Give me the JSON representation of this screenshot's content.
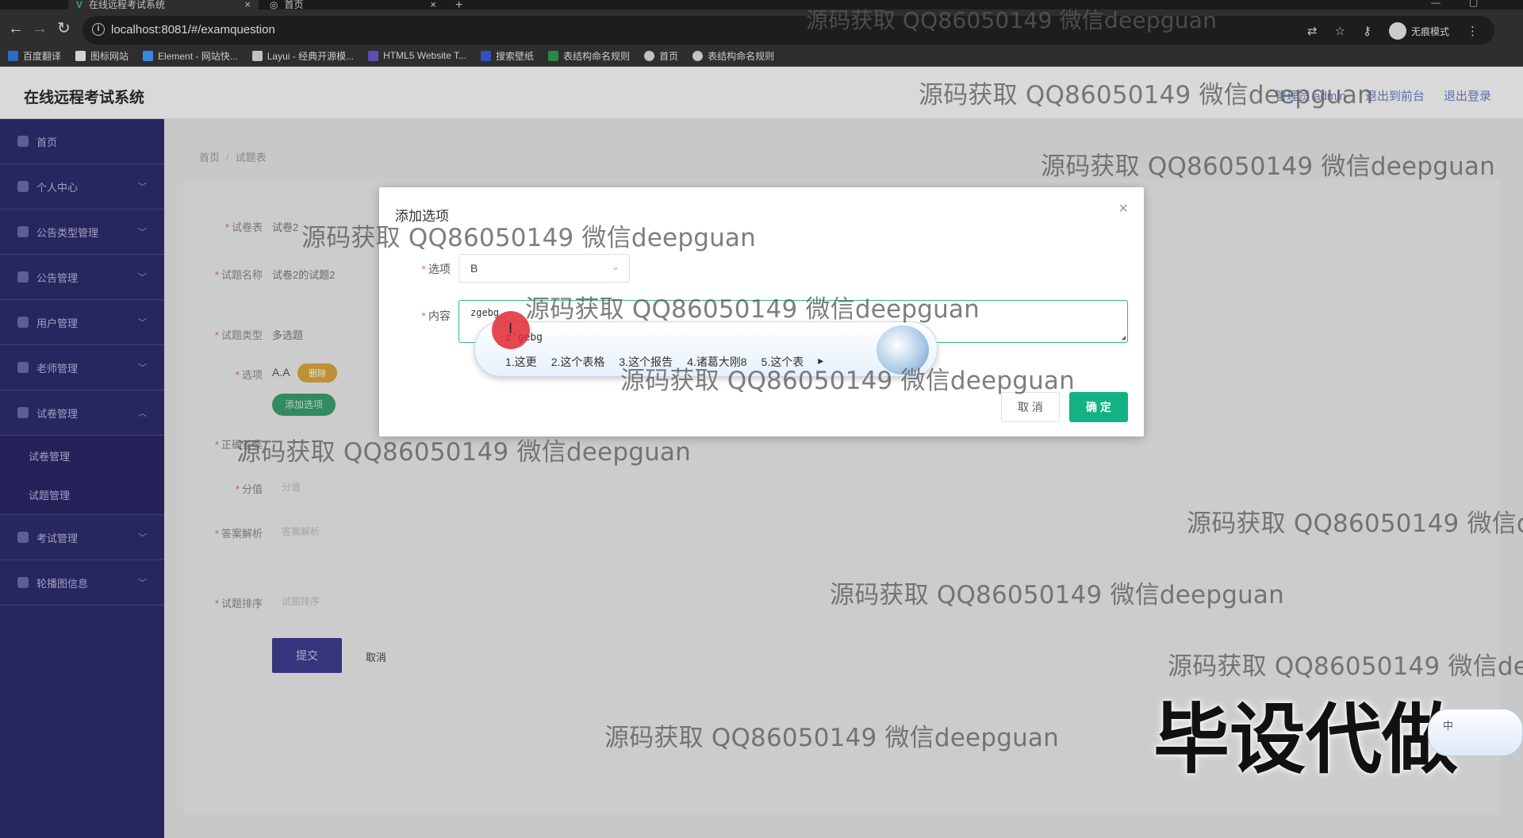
{
  "browser": {
    "tabs": [
      {
        "title": "在线远程考试系统",
        "active": true
      },
      {
        "title": "首页",
        "active": false
      }
    ],
    "url": "localhost:8081/#/examquestion",
    "incognito_label": "无痕模式",
    "bookmarks": [
      {
        "label": "百度翻译",
        "color": "#2f7de1"
      },
      {
        "label": "图标网站",
        "color": "#f0f0f0"
      },
      {
        "label": "Element - 网站快...",
        "color": "#409eff"
      },
      {
        "label": "Layui - 经典开源模...",
        "color": "#dddddd"
      },
      {
        "label": "HTML5 Website T...",
        "color": "#6a5acd"
      },
      {
        "label": "搜索壁纸",
        "color": "#3b5bdb"
      },
      {
        "label": "表结构命名规则",
        "color": "#2e9e4f"
      },
      {
        "label": "首页",
        "color": "#dddddd"
      },
      {
        "label": "表结构命名规则",
        "color": "#dddddd"
      }
    ]
  },
  "header": {
    "title": "在线远程考试系统",
    "links": [
      "管理员 admin",
      "退出到前台",
      "退出登录"
    ]
  },
  "sidebar": {
    "items": [
      {
        "label": "首页",
        "has_chevron": false
      },
      {
        "label": "个人中心",
        "has_chevron": true
      },
      {
        "label": "公告类型管理",
        "has_chevron": true
      },
      {
        "label": "公告管理",
        "has_chevron": true
      },
      {
        "label": "用户管理",
        "has_chevron": true
      },
      {
        "label": "老师管理",
        "has_chevron": true
      },
      {
        "label": "试卷管理",
        "has_chevron": true,
        "expanded": true
      },
      {
        "label": "考试管理",
        "has_chevron": true
      },
      {
        "label": "轮播图信息",
        "has_chevron": true
      }
    ],
    "submenu": [
      "试卷管理",
      "试题管理"
    ]
  },
  "breadcrumb": [
    "首页",
    "试题表"
  ],
  "form": {
    "paper_label": "试卷表",
    "paper_value": "试卷2",
    "question_name_label": "试题名称",
    "question_name_value": "试卷2的试题2",
    "type_label": "试题类型",
    "type_value": "多选题",
    "options_label": "选项",
    "option_item": "A.A",
    "delete_label": "删除",
    "add_option_label": "添加选项",
    "answer_label": "正确答案",
    "score_label": "分值",
    "score_placeholder": "分值",
    "analysis_label": "答案解析",
    "analysis_placeholder": "答案解析",
    "sort_label": "试题排序",
    "sort_placeholder": "试题排序",
    "submit_label": "提交",
    "cancel_label": "取消"
  },
  "dialog": {
    "title": "添加选项",
    "option_label": "选项",
    "option_value": "B",
    "content_label": "内容",
    "content_value": "zgebg",
    "cancel_label": "取 消",
    "confirm_label": "确 定"
  },
  "ime": {
    "composition": "z'gebg",
    "candidates": [
      "1.这更",
      "2.这个表格",
      "3.这个报告",
      "4.诸葛大刚8",
      "5.这个表"
    ]
  },
  "watermarks": [
    "源码获取 QQ86050149 微信deepguan",
    "源码获取 QQ86050149 微信deepguan",
    "源码获取 QQ86050149 微信deepguan",
    "源码获取 QQ86050149 微信deepguan",
    "源码获取 QQ86050149 微信deepguan",
    "源码获取 QQ86050149 微信deepguan",
    "源码获取 QQ86050149 微信deepguan",
    "源码获取 QQ86050149 微信de",
    "源码获取 QQ86050149 微信deepguan",
    "源码获取 QQ86050149 微信deep",
    "源码获取 QQ86050149 微信deepguan"
  ],
  "overlay_text": "毕设代做",
  "ime_mini_label": "中",
  "colors": {
    "sidebar": "#2e2c6b",
    "confirm": "#13b283",
    "focus_border": "#3bb58e"
  }
}
